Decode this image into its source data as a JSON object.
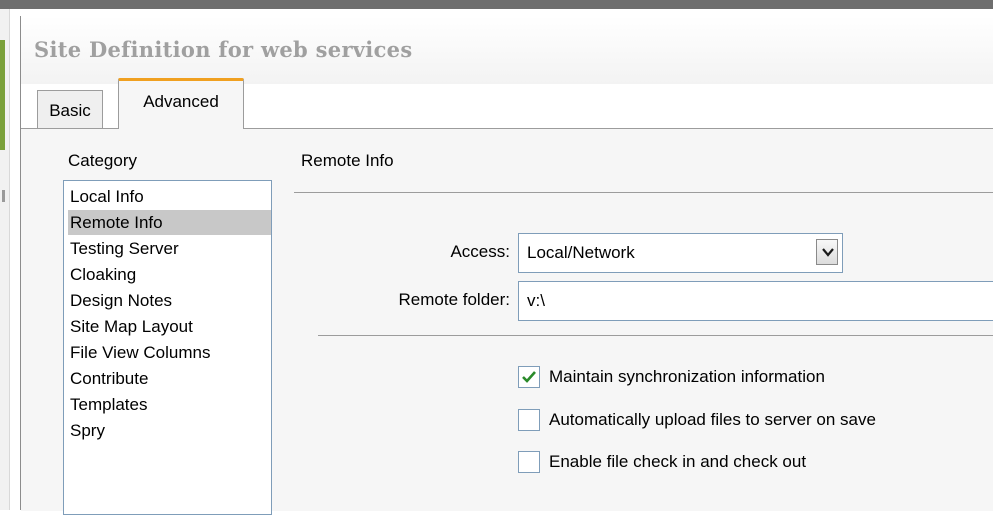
{
  "window": {
    "title": "Site Definition for web services"
  },
  "tabs": [
    {
      "label": "Basic",
      "active": false
    },
    {
      "label": "Advanced",
      "active": true
    }
  ],
  "category": {
    "label": "Category",
    "items": [
      "Local Info",
      "Remote Info",
      "Testing Server",
      "Cloaking",
      "Design Notes",
      "Site Map Layout",
      "File View Columns",
      "Contribute",
      "Templates",
      "Spry"
    ],
    "selected": "Remote Info"
  },
  "section": {
    "title": "Remote Info"
  },
  "fields": {
    "access": {
      "label": "Access:",
      "value": "Local/Network"
    },
    "remote_folder": {
      "label": "Remote folder:",
      "value": "v:\\"
    }
  },
  "checkboxes": [
    {
      "label": "Maintain synchronization information",
      "checked": true
    },
    {
      "label": "Automatically upload files to server on save",
      "checked": false
    },
    {
      "label": "Enable file check in and check out",
      "checked": false
    }
  ],
  "icons": {
    "dropdown": "chevron-down-icon",
    "check": "checkmark-icon"
  },
  "colors": {
    "tab_accent": "#f0a020",
    "selection": "#c8c8c8",
    "check": "#2a8a2a"
  }
}
